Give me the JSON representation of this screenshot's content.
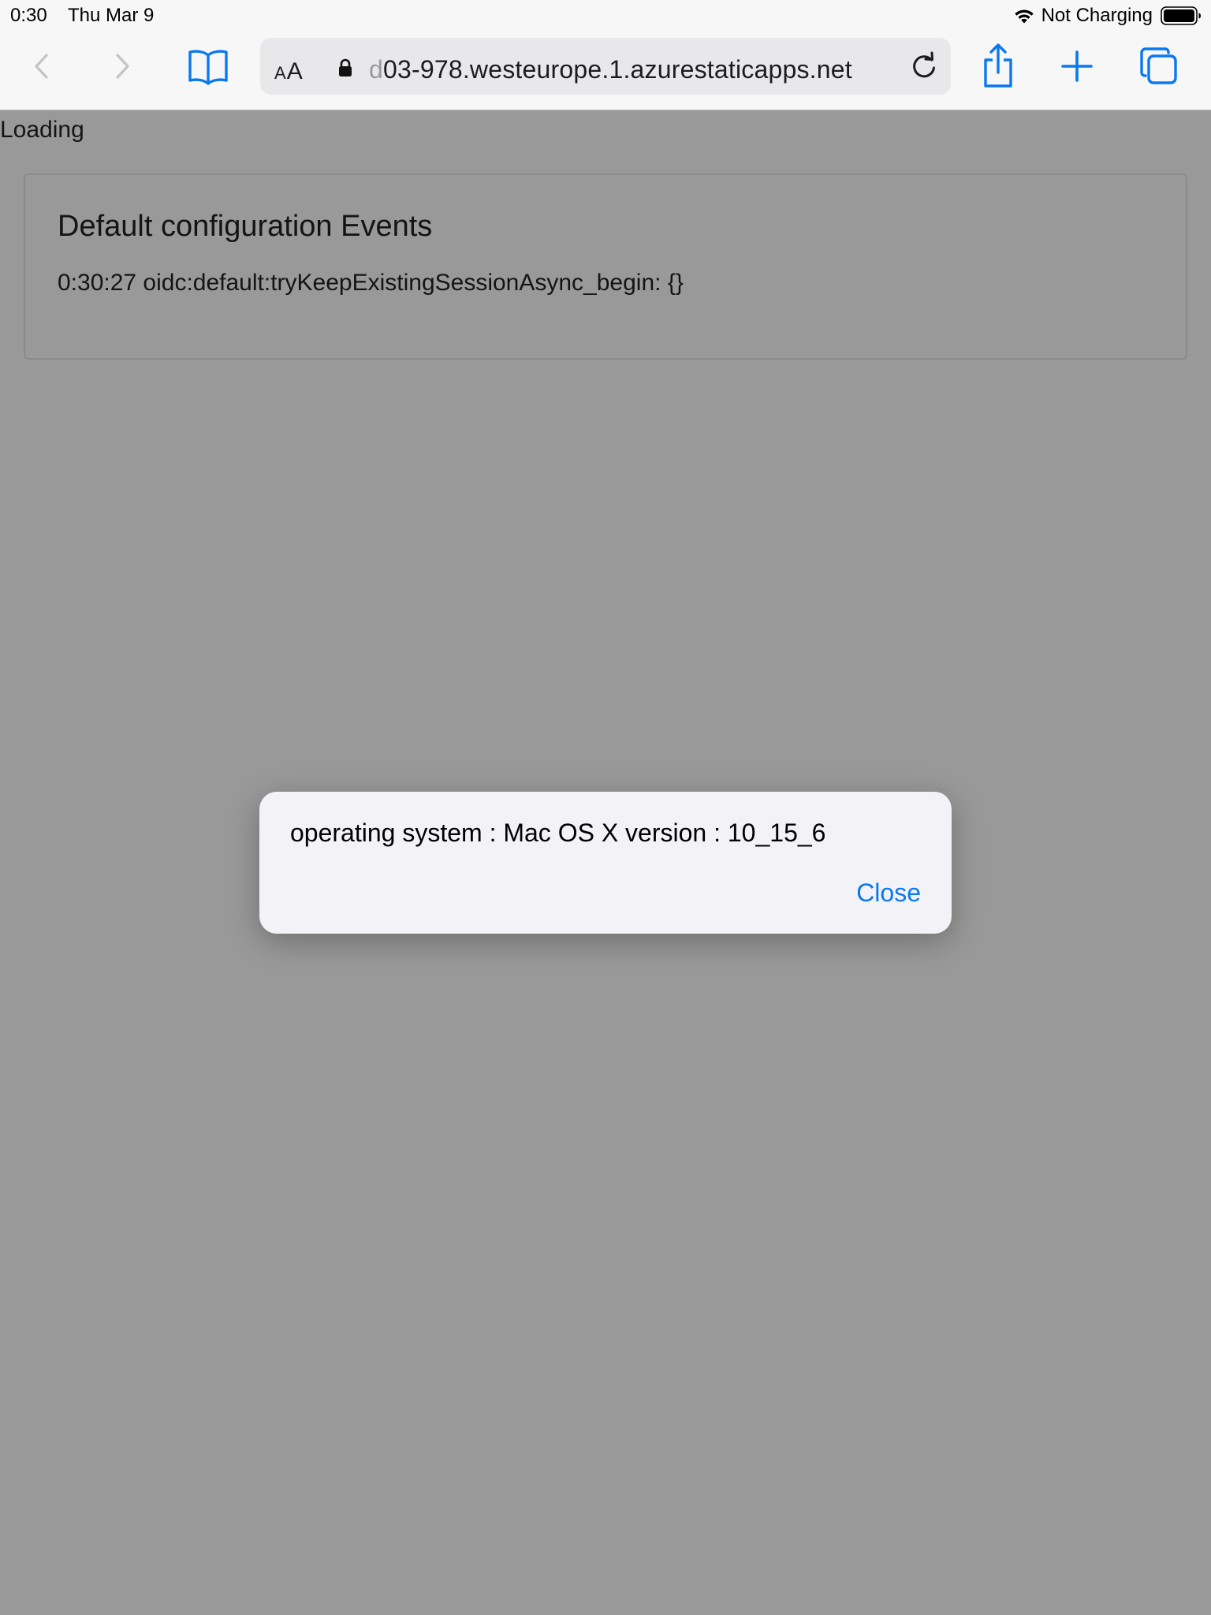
{
  "status_bar": {
    "time": "0:30",
    "date": "Thu Mar 9",
    "charging_status": "Not Charging",
    "icons": [
      "wifi-icon",
      "battery-icon"
    ]
  },
  "toolbar": {
    "icons": [
      "chevron-left-icon",
      "chevron-right-icon",
      "book-icon",
      "lock-icon",
      "reload-icon",
      "share-icon",
      "plus-icon",
      "tabs-icon"
    ],
    "text_size_small": "A",
    "text_size_large": "A",
    "url_faded_prefix": "d",
    "url": "03-978.westeurope.1.azurestaticapps.net",
    "accent_color": "#0a78f0"
  },
  "page": {
    "loading_text": "Loading",
    "events_card": {
      "title": "Default configuration Events",
      "entries": [
        "0:30:27 oidc:default:tryKeepExistingSessionAsync_begin: {}"
      ]
    },
    "background_color": "#999999"
  },
  "alert": {
    "message": "operating system : Mac OS X version : 10_15_6",
    "close_label": "Close"
  }
}
